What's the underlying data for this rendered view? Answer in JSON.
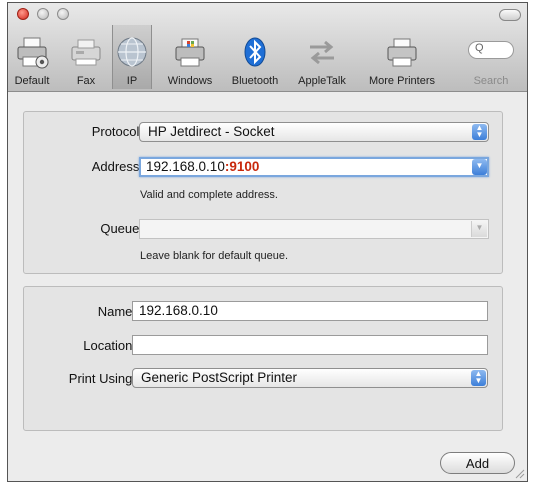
{
  "toolbar": {
    "items": [
      {
        "label": "Default",
        "icon": "default-printer-icon"
      },
      {
        "label": "Fax",
        "icon": "fax-icon"
      },
      {
        "label": "IP",
        "icon": "ip-globe-icon",
        "selected": true
      },
      {
        "label": "Windows",
        "icon": "windows-printer-icon"
      },
      {
        "label": "Bluetooth",
        "icon": "bluetooth-icon"
      },
      {
        "label": "AppleTalk",
        "icon": "appletalk-arrows-icon"
      },
      {
        "label": "More Printers",
        "icon": "more-printers-icon"
      },
      {
        "label": "Search",
        "icon": "search-icon"
      }
    ],
    "search_glyph": "Q"
  },
  "connection": {
    "protocol_label": "Protocol:",
    "protocol_value": "HP Jetdirect - Socket",
    "address_label": "Address:",
    "address_host": "192.168.0.10",
    "address_port": ":9100",
    "address_hint": "Valid and complete address.",
    "queue_label": "Queue:",
    "queue_value": "",
    "queue_hint": "Leave blank for default queue."
  },
  "printer": {
    "name_label": "Name:",
    "name_value": "192.168.0.10",
    "location_label": "Location:",
    "location_value": "",
    "print_using_label": "Print Using:",
    "print_using_value": "Generic PostScript Printer"
  },
  "actions": {
    "add_label": "Add"
  },
  "colors": {
    "focus": "#7aa7de",
    "port": "#c8280c",
    "stepper": "#3d7fd9",
    "close": "#d3261b"
  }
}
